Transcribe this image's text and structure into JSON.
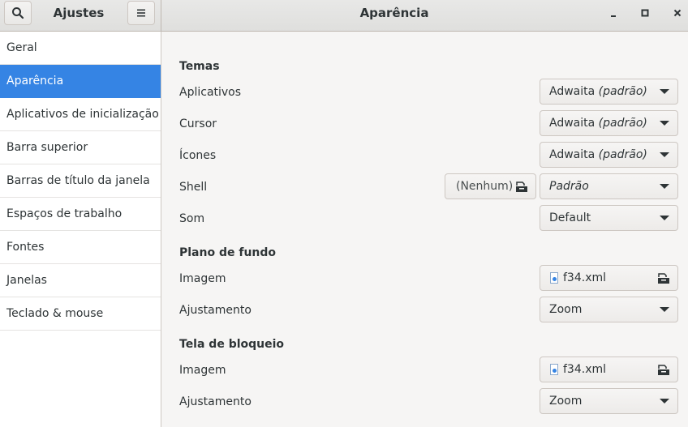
{
  "header": {
    "app_title": "Ajustes",
    "window_title": "Aparência",
    "icons": {
      "search": "search-icon",
      "menu": "hamburger-menu-icon",
      "minimize": "minimize-icon",
      "maximize": "maximize-icon",
      "close": "close-icon"
    }
  },
  "sidebar": {
    "items": [
      {
        "label": "Geral"
      },
      {
        "label": "Aparência",
        "active": true
      },
      {
        "label": "Aplicativos de inicialização"
      },
      {
        "label": "Barra superior"
      },
      {
        "label": "Barras de título da janela"
      },
      {
        "label": "Espaços de trabalho"
      },
      {
        "label": "Fontes"
      },
      {
        "label": "Janelas"
      },
      {
        "label": "Teclado & mouse"
      }
    ]
  },
  "themes": {
    "title": "Temas",
    "applications": {
      "label": "Aplicativos",
      "value": "Adwaita",
      "suffix": "(padrão)"
    },
    "cursor": {
      "label": "Cursor",
      "value": "Adwaita",
      "suffix": "(padrão)"
    },
    "icons": {
      "label": "Ícones",
      "value": "Adwaita",
      "suffix": "(padrão)"
    },
    "shell": {
      "label": "Shell",
      "file_label": "(Nenhum)",
      "value": "Padrão"
    },
    "sound": {
      "label": "Som",
      "value": "Default"
    }
  },
  "background": {
    "title": "Plano de fundo",
    "image": {
      "label": "Imagem",
      "file": "f34.xml"
    },
    "adjustment": {
      "label": "Ajustamento",
      "value": "Zoom"
    }
  },
  "lockscreen": {
    "title": "Tela de bloqueio",
    "image": {
      "label": "Imagem",
      "file": "f34.xml"
    },
    "adjustment": {
      "label": "Ajustamento",
      "value": "Zoom"
    }
  },
  "colors": {
    "accent": "#3584e4",
    "bg": "#f6f5f4",
    "text": "#2e3436"
  }
}
